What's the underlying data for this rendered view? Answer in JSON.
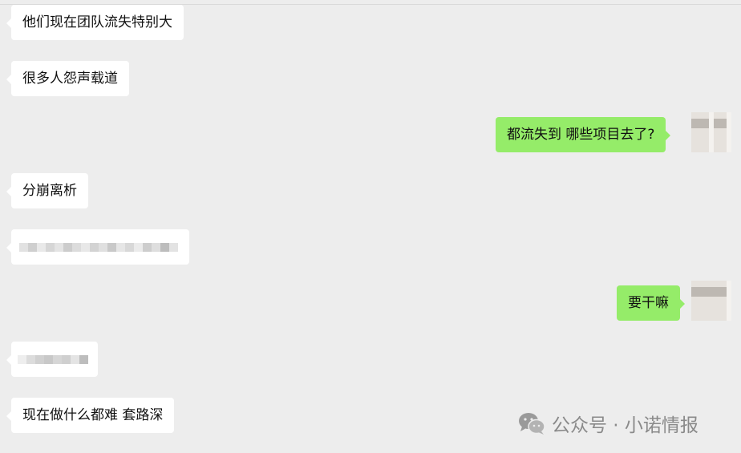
{
  "messages": [
    {
      "id": "m1",
      "side": "in",
      "text": "他们现在团队流失特别大"
    },
    {
      "id": "m2",
      "side": "in",
      "text": "很多人怨声载道"
    },
    {
      "id": "m3",
      "side": "out",
      "text": "都流失到  哪些项目去了?"
    },
    {
      "id": "m4",
      "side": "in",
      "text": "分崩离析"
    },
    {
      "id": "m5",
      "side": "in",
      "text": ""
    },
    {
      "id": "m6",
      "side": "out",
      "text": "要干嘛"
    },
    {
      "id": "m7",
      "side": "in",
      "text": ""
    },
    {
      "id": "m8",
      "side": "in",
      "text": "现在做什么都难 套路深"
    }
  ],
  "watermark": {
    "text": "公众号 · 小诺情报",
    "icon": "wechat-icon"
  },
  "colors": {
    "background": "#ededed",
    "incoming": "#ffffff",
    "outgoing": "#95ec69",
    "watermark": "#8a8a8a"
  }
}
